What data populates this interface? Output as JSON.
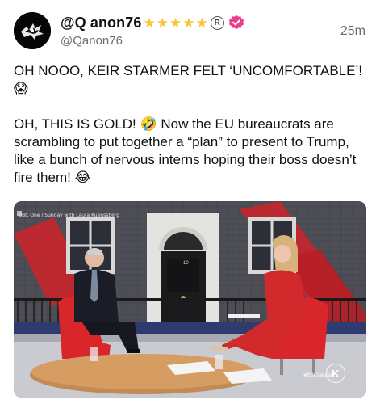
{
  "post": {
    "display_name": "@Q anon76",
    "handle": "@Qanon76",
    "timestamp": "25m",
    "star_count": 5,
    "reg_mark": "R",
    "paragraph1": "OH NOOO, KEIR STARMER FELT ‘UNCOMFORTABLE’!",
    "paragraph2": "OH, THIS IS GOLD! 🤣 Now the EU bureaucrats are scrambling to put together a “plan” to present to Trump, like a bunch of nervous interns hoping their boss doesn’t fire them! 😂",
    "emoji1": "😱",
    "icons": {
      "avatar": "avatar-image",
      "verified": "verified-badge-icon",
      "star": "star-icon"
    }
  },
  "media": {
    "caption": "BBC One / Sunday with Laura Kuenssberg",
    "hashtag": "#BBCLauraK",
    "door_number": "10",
    "channel_logo": "K"
  },
  "colors": {
    "star": "#f6c634",
    "verified": "#ee3d8c",
    "handle_gray": "#6b6b6b",
    "chair_red": "#d8262b"
  }
}
